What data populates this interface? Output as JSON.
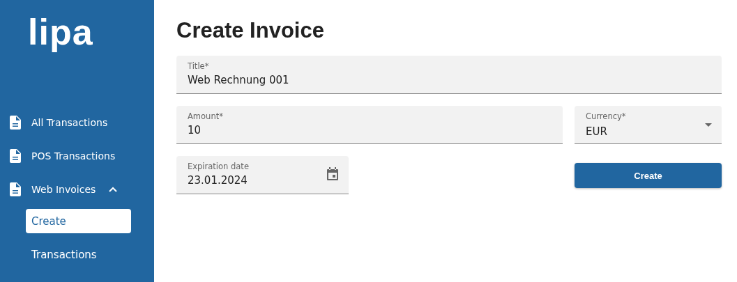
{
  "logo": "lipa",
  "nav": [
    {
      "label": "All Transactions"
    },
    {
      "label": "POS Transactions"
    },
    {
      "label": "Web Invoices",
      "expanded": true,
      "children": [
        {
          "label": "Create",
          "selected": true
        },
        {
          "label": "Transactions",
          "selected": false
        }
      ]
    }
  ],
  "page_title": "Create Invoice",
  "title_field": {
    "label": "Title*",
    "value": "Web Rechnung 001"
  },
  "amount_field": {
    "label": "Amount*",
    "value": "10"
  },
  "currency_field": {
    "label": "Currency*",
    "value": "EUR"
  },
  "date_field": {
    "label": "Expiration date",
    "value": "23.01.2024"
  },
  "create_button": "Create"
}
